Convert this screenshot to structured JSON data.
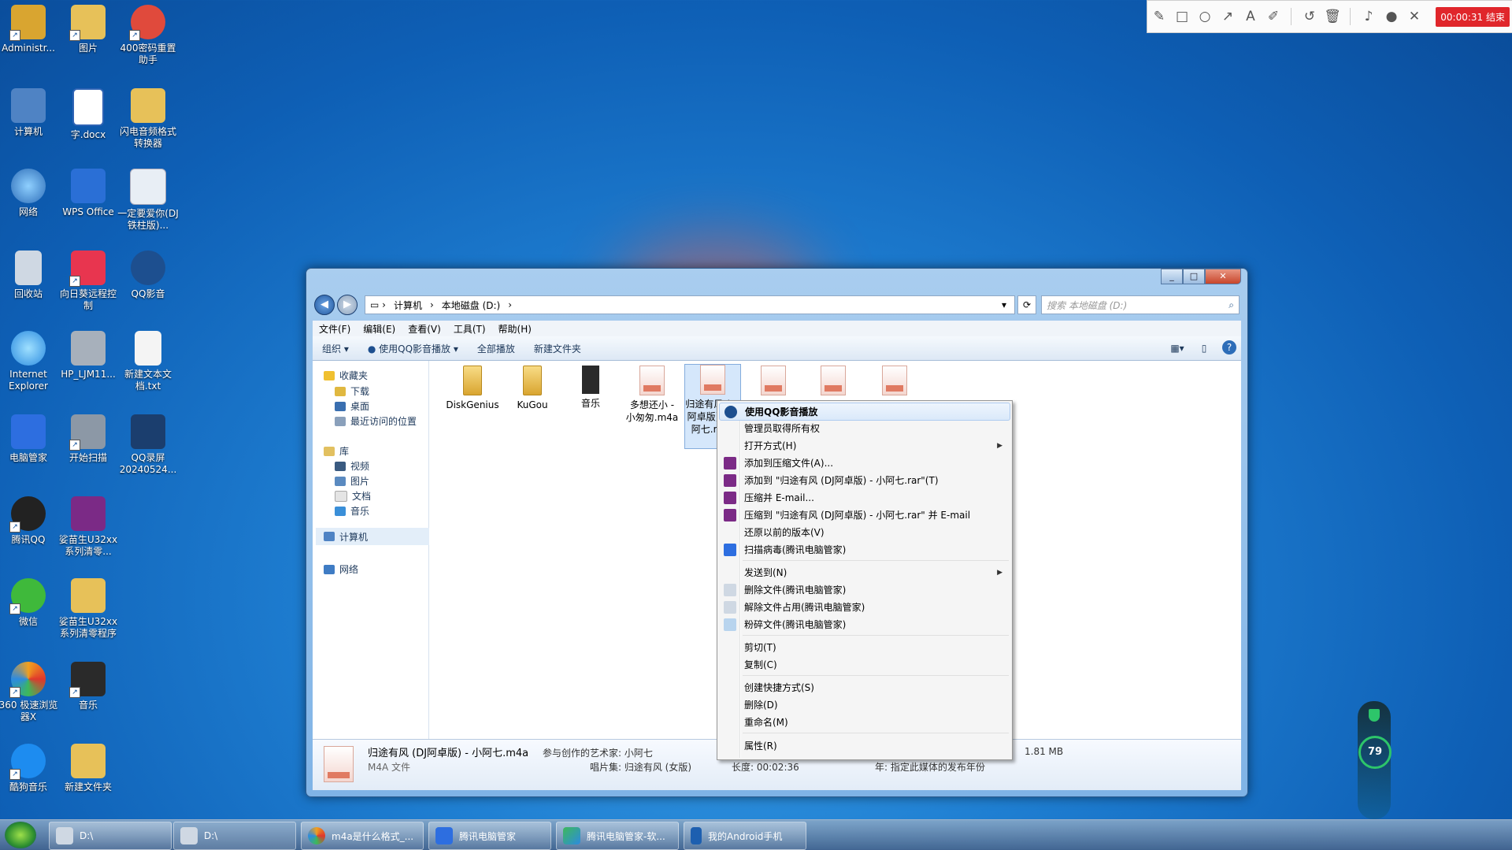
{
  "desktop": {
    "icons": [
      {
        "label": "Administr...",
        "icon": "user-folder-icon",
        "color": "#d9a530"
      },
      {
        "label": "图片",
        "icon": "folder-icon",
        "color": "#e7c159"
      },
      {
        "label": "400密码重置助手",
        "icon": "reset-tool-icon",
        "color": "#e04a3c"
      },
      {
        "label": "计算机",
        "icon": "computer-icon",
        "color": "#4f83c4"
      },
      {
        "label": "字.docx",
        "icon": "word-doc-icon",
        "color": "#2f64b5"
      },
      {
        "label": "闪电音频格式转换器",
        "icon": "folder-icon",
        "color": "#e7c159"
      },
      {
        "label": "网络",
        "icon": "network-icon",
        "color": "#3f7cc4"
      },
      {
        "label": "WPS Office",
        "icon": "wps-icon",
        "color": "#2a6fd6"
      },
      {
        "label": "一定要爱你(DJ铁柱版)...",
        "icon": "mp3-file-icon",
        "color": "#e8eef5"
      },
      {
        "label": "回收站",
        "icon": "recycle-bin-icon",
        "color": "#cfd8e3"
      },
      {
        "label": "向日葵远程控制",
        "icon": "sunflower-icon",
        "color": "#e8354f"
      },
      {
        "label": "QQ影音",
        "icon": "qq-player-icon",
        "color": "#1d4f8f"
      },
      {
        "label": "Internet Explorer",
        "icon": "ie-icon",
        "color": "#2b8be0"
      },
      {
        "label": "HP_LJM11...",
        "icon": "printer-icon",
        "color": "#a7b0bb"
      },
      {
        "label": "新建文本文档.txt",
        "icon": "text-file-icon",
        "color": "#f4f4f4"
      },
      {
        "label": "电脑管家",
        "icon": "pc-manager-icon",
        "color": "#2d6ee0"
      },
      {
        "label": "开始扫描",
        "icon": "scanner-icon",
        "color": "#8c98a6"
      },
      {
        "label": "QQ录屏20240524...",
        "icon": "screen-record-icon",
        "color": "#1b3e6e"
      },
      {
        "label": "腾讯QQ",
        "icon": "qq-icon",
        "color": "#222222"
      },
      {
        "label": "娑苗生U32xx系列清零...",
        "icon": "archive-icon",
        "color": "#7b2a86"
      },
      {
        "label": "微信",
        "icon": "wechat-icon",
        "color": "#3fb93b"
      },
      {
        "label": "娑苗生U32xx系列清零程序",
        "icon": "folder-icon",
        "color": "#e7c159"
      },
      {
        "label": "360 极速浏览器X",
        "icon": "browser-360-icon",
        "color": "#f0a020"
      },
      {
        "label": "音乐",
        "icon": "music-folder-icon",
        "color": "#2a2a2a"
      },
      {
        "label": "酷狗音乐",
        "icon": "kugou-icon",
        "color": "#1d8cf0"
      },
      {
        "label": "新建文件夹",
        "icon": "folder-icon",
        "color": "#e7c159"
      }
    ]
  },
  "recorder": {
    "tools": [
      "pencil-icon",
      "rectangle-icon",
      "circle-icon",
      "arrow-icon",
      "text-icon",
      "highlighter-icon",
      "undo-icon",
      "trash-icon",
      "speaker-icon",
      "microphone-icon",
      "close-icon"
    ],
    "timer": "00:00:31 结束"
  },
  "explorer": {
    "breadcrumb": [
      "计算机",
      "本地磁盘 (D:)"
    ],
    "search_placeholder": "搜索 本地磁盘 (D:)",
    "menu": [
      "文件(F)",
      "编辑(E)",
      "查看(V)",
      "工具(T)",
      "帮助(H)"
    ],
    "commands": [
      "组织 ▾",
      "使用QQ影音播放 ▾",
      "全部播放",
      "新建文件夹"
    ],
    "nav": {
      "favorites": "收藏夹",
      "fav_items": [
        "下载",
        "桌面",
        "最近访问的位置"
      ],
      "library": "库",
      "lib_items": [
        "视频",
        "图片",
        "文档",
        "音乐"
      ],
      "computer": "计算机",
      "network": "网络"
    },
    "files": [
      {
        "name": "DiskGenius",
        "type": "folder"
      },
      {
        "name": "KuGou",
        "type": "folder"
      },
      {
        "name": "音乐",
        "type": "folder-dark"
      },
      {
        "name": "多想还小 - 小匆匆.m4a",
        "type": "m4a"
      },
      {
        "name": "归途有风 (DJ阿卓版) - 小阿七.m4a",
        "type": "m4a"
      },
      {
        "name": "",
        "type": "m4a"
      },
      {
        "name": "",
        "type": "m4a"
      },
      {
        "name": "",
        "type": "m4a"
      }
    ],
    "details": {
      "filename": "归途有风 (DJ阿卓版) - 小阿七.m4a",
      "artist_label": "参与创作的艺术家: 小阿七",
      "filetype": "M4A 文件",
      "album": "唱片集: 归途有风 (女版)",
      "length": "长度: 00:02:36",
      "year": "年: 指定此媒体的发布年份",
      "size": "1.81 MB"
    }
  },
  "context_menu": {
    "items": [
      {
        "label": "使用QQ影音播放",
        "icon": "qq-player-icon",
        "highlight": true
      },
      {
        "label": "管理员取得所有权"
      },
      {
        "label": "打开方式(H)",
        "submenu": true
      },
      {
        "label": "添加到压缩文件(A)...",
        "icon": "winrar-icon"
      },
      {
        "label": "添加到 \"归途有风 (DJ阿卓版) - 小阿七.rar\"(T)",
        "icon": "winrar-icon"
      },
      {
        "label": "压缩并 E-mail...",
        "icon": "winrar-icon"
      },
      {
        "label": "压缩到 \"归途有风 (DJ阿卓版) - 小阿七.rar\" 并 E-mail",
        "icon": "winrar-icon"
      },
      {
        "label": "还原以前的版本(V)"
      },
      {
        "label": "扫描病毒(腾讯电脑管家)",
        "icon": "pc-manager-icon"
      },
      {
        "label": "发送到(N)",
        "submenu": true
      },
      {
        "label": "删除文件(腾讯电脑管家)",
        "icon": "delete-file-icon"
      },
      {
        "label": "解除文件占用(腾讯电脑管家)",
        "icon": "unlock-file-icon"
      },
      {
        "label": "粉碎文件(腾讯电脑管家)",
        "icon": "shred-file-icon"
      },
      {
        "label": "剪切(T)"
      },
      {
        "label": "复制(C)"
      },
      {
        "label": "创建快捷方式(S)"
      },
      {
        "label": "删除(D)"
      },
      {
        "label": "重命名(M)"
      },
      {
        "label": "属性(R)"
      }
    ]
  },
  "taskbar": {
    "buttons": [
      "D:\\",
      "D:\\",
      "m4a是什么格式_...",
      "腾讯电脑管家",
      "腾讯电脑管家-软...",
      "我的Android手机"
    ]
  },
  "gauge": {
    "value": "79"
  }
}
